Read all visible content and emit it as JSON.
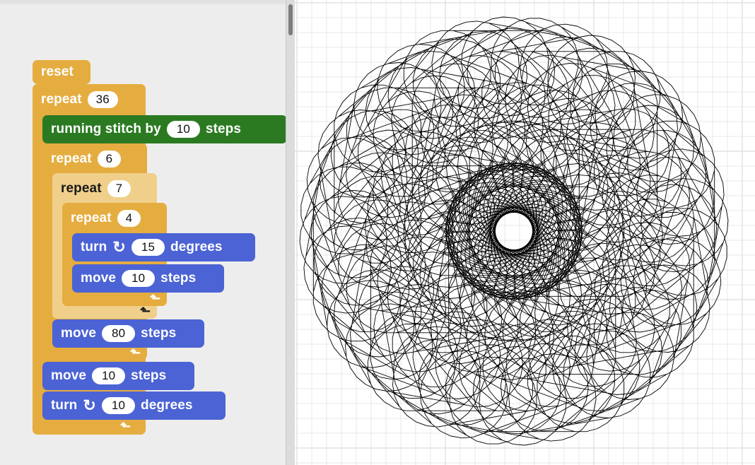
{
  "script": {
    "reset": "reset",
    "repeat_outer": {
      "label": "repeat",
      "count": "36"
    },
    "running_stitch": {
      "label": "running stitch by",
      "value": "10",
      "unit": "steps"
    },
    "repeat_6": {
      "label": "repeat",
      "count": "6"
    },
    "repeat_7": {
      "label": "repeat",
      "count": "7"
    },
    "repeat_4": {
      "label": "repeat",
      "count": "4"
    },
    "turn_inner": {
      "label": "turn",
      "icon": "rotate-clockwise-icon",
      "value": "15",
      "unit": "degrees"
    },
    "move_inner": {
      "label": "move",
      "value": "10",
      "unit": "steps"
    },
    "move_80": {
      "label": "move",
      "value": "80",
      "unit": "steps"
    },
    "move_outer": {
      "label": "move",
      "value": "10",
      "unit": "steps"
    },
    "turn_outer": {
      "label": "turn",
      "icon": "rotate-clockwise-icon",
      "value": "10",
      "unit": "degrees"
    }
  },
  "colors": {
    "control": "#e5ad3f",
    "control_light": "#f0cf8b",
    "motion": "#4b63d4",
    "embroidery": "#2b7a22",
    "stage_grid": "#e2e2e2",
    "stitch_line": "#000000"
  }
}
